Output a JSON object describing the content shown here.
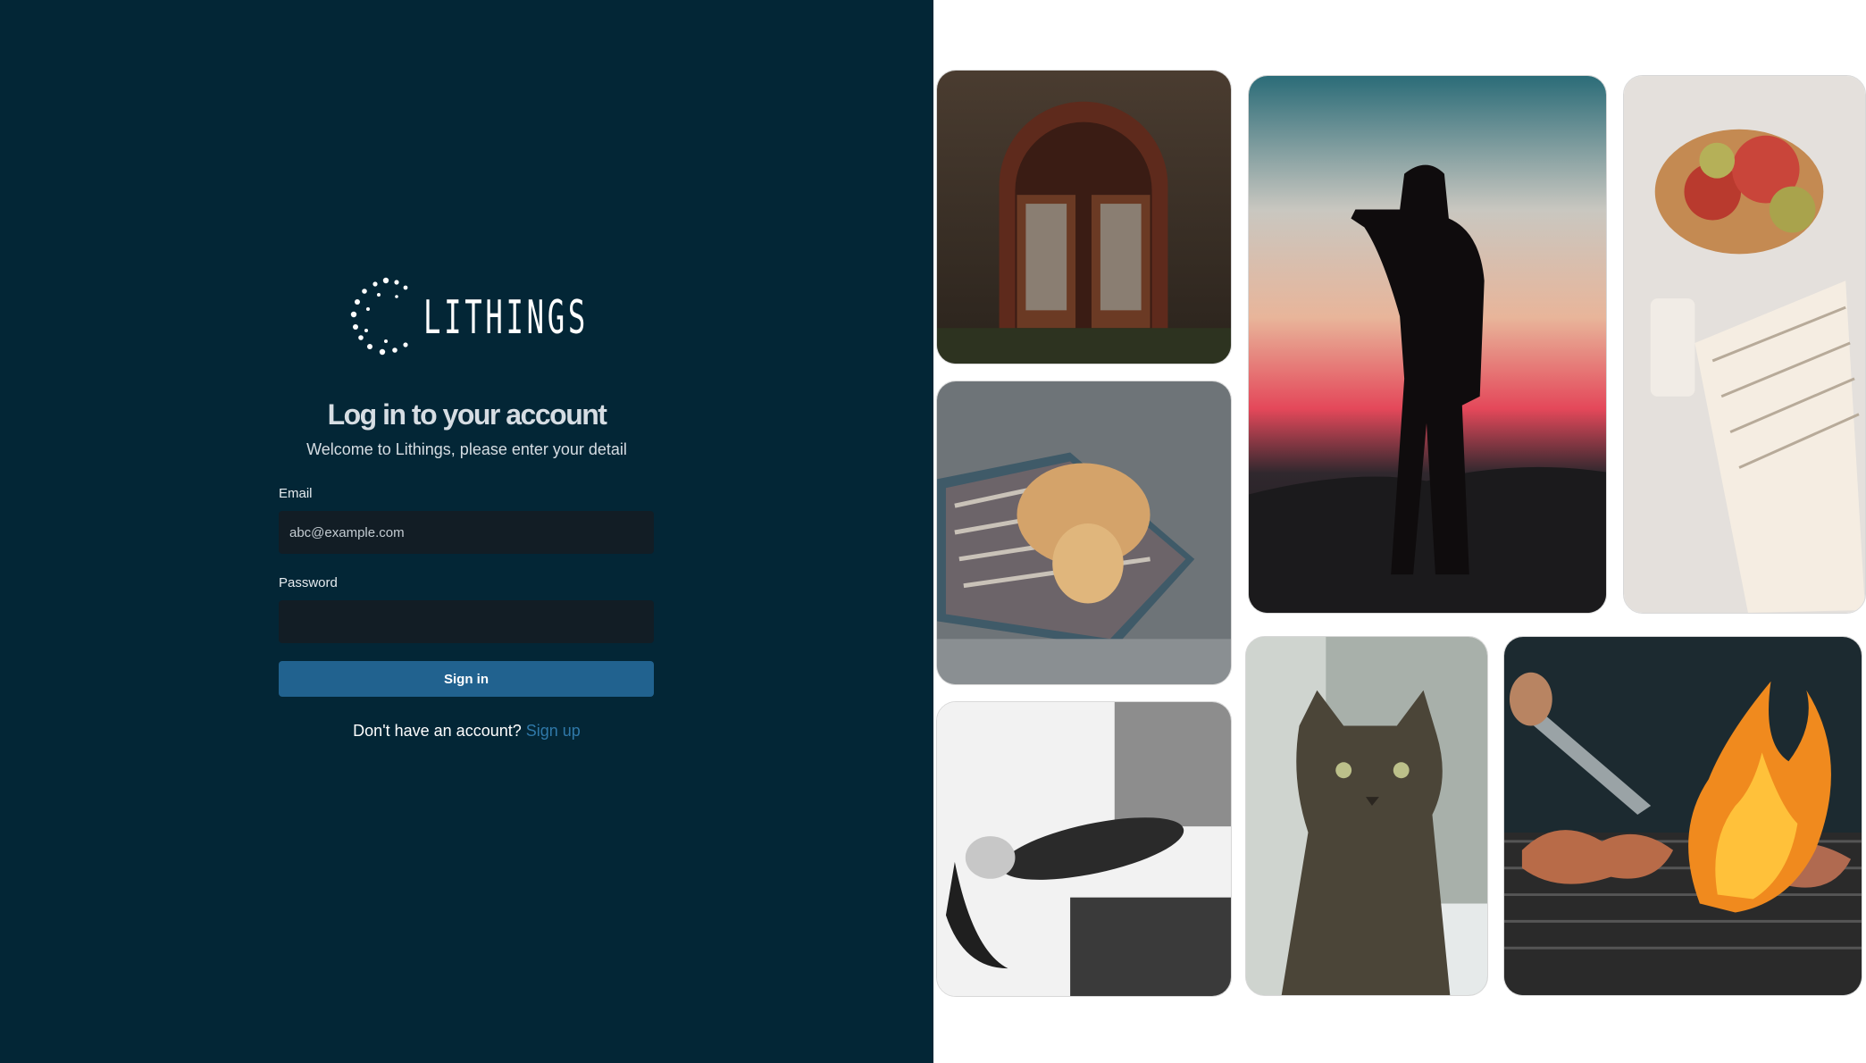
{
  "brand": {
    "logo_text": "LITHINGS"
  },
  "login": {
    "title": "Log in to your account",
    "subtitle": "Welcome to Lithings, please enter your detail",
    "email_label": "Email",
    "email_placeholder": "abc@example.com",
    "password_label": "Password",
    "password_placeholder": "",
    "signin_label": "Sign in",
    "no_account_text": "Don't have an account?",
    "signup_label": "Sign up"
  },
  "gallery": {
    "images": [
      "arched-window",
      "photographer-silhouette",
      "apples-and-book",
      "puppy-on-rug",
      "woman-lying-down",
      "tabby-cat",
      "grill-fire"
    ]
  },
  "colors": {
    "panel_bg": "#032636",
    "input_bg": "#121d25",
    "button_bg": "#21628f",
    "link": "#2f78a8"
  }
}
